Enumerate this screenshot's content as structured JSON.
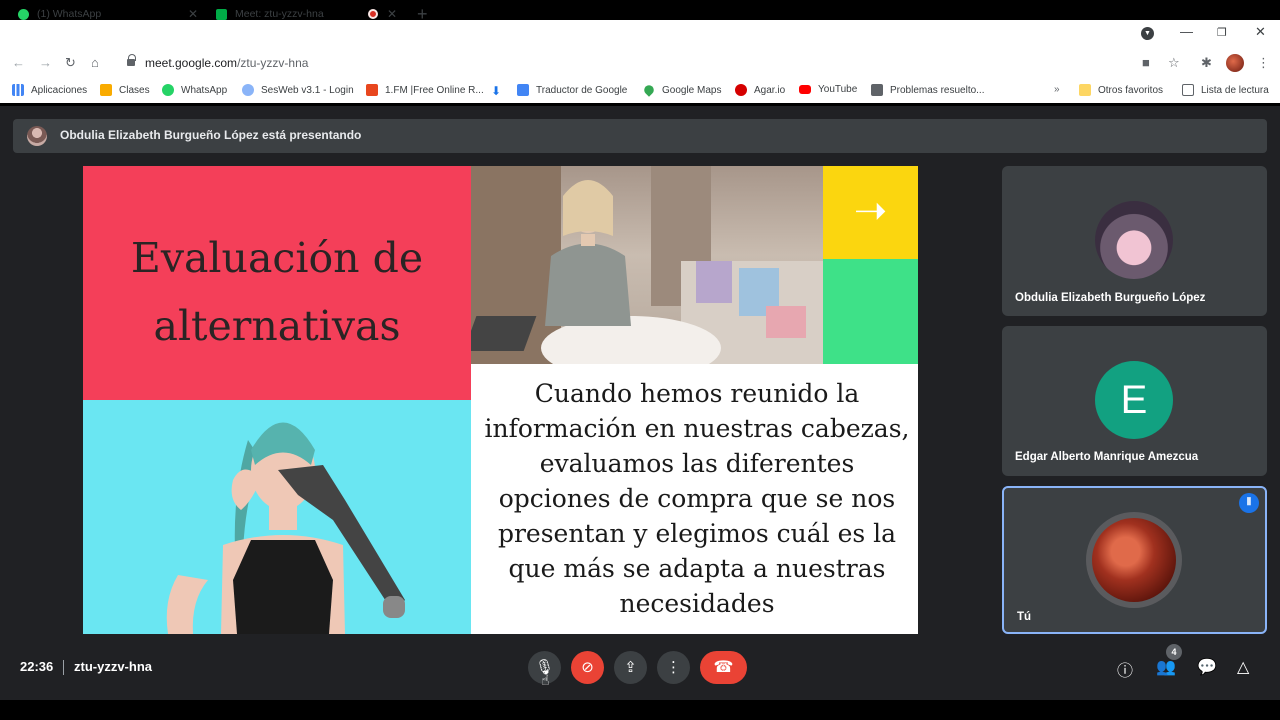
{
  "tabs": [
    {
      "label": "(1) WhatsApp",
      "icon": "whatsapp-icon",
      "color": "#25d366"
    },
    {
      "label": "Meet: ztu-yzzv-hna",
      "icon": "meet-icon",
      "color": "#00ac47"
    }
  ],
  "address": {
    "host": "meet.google.com",
    "path": "/ztu-yzzv-hna"
  },
  "bookmarks": [
    {
      "label": "Aplicaciones",
      "icon": "apps-grid-icon",
      "color": "#4285f4"
    },
    {
      "label": "Clases",
      "icon": "classroom-icon",
      "color": "#f9ab00"
    },
    {
      "label": "WhatsApp",
      "icon": "whatsapp-icon",
      "color": "#25d366"
    },
    {
      "label": "SesWeb v3.1 - Login",
      "icon": "sesweb-icon",
      "color": "#8ab4f8"
    },
    {
      "label": "1.FM |Free Online R...",
      "icon": "radio-icon",
      "color": "#e8461e"
    },
    {
      "label": "",
      "icon": "download-icon",
      "color": "#1a73e8"
    },
    {
      "label": "Traductor de Google",
      "icon": "translate-icon",
      "color": "#4285f4"
    },
    {
      "label": "Google Maps",
      "icon": "maps-icon",
      "color": "#34a853"
    },
    {
      "label": "Agar.io",
      "icon": "agar-icon",
      "color": "#d50000"
    },
    {
      "label": "YouTube",
      "icon": "youtube-icon",
      "color": "#ff0000"
    },
    {
      "label": "Problemas resuelto...",
      "icon": "problems-icon",
      "color": "#5f6368"
    },
    {
      "label": "Otros favoritos",
      "icon": "folder-icon",
      "color": "#fdd663"
    },
    {
      "label": "Lista de lectura",
      "icon": "reading-list-icon",
      "color": "#5f6368"
    }
  ],
  "presenter_bar": {
    "text": "Obdulia Elizabeth Burgueño López está presentando"
  },
  "slide": {
    "title_line1": "Evaluación de",
    "title_line2": "alternativas",
    "body": "Cuando hemos reunido la información en nuestras cabezas, evaluamos las diferentes opciones de compra que se nos presentan y elegimos cuál es la que más se adapta a nuestras necesidades",
    "colors": {
      "red": "#f43f59",
      "yellow": "#fbd60f",
      "green": "#3ee188",
      "cyan": "#6ae6f2"
    }
  },
  "participants": [
    {
      "name": "Obdulia Elizabeth Burgueño López",
      "avatar": "photo"
    },
    {
      "name": "Edgar Alberto Manrique Amezcua",
      "initial": "E",
      "avatar_color": "#12a181"
    },
    {
      "name": "Tú",
      "avatar": "moon-photo"
    }
  ],
  "footer": {
    "time": "22:36",
    "code": "ztu-yzzv-hna",
    "participant_count": "4"
  }
}
